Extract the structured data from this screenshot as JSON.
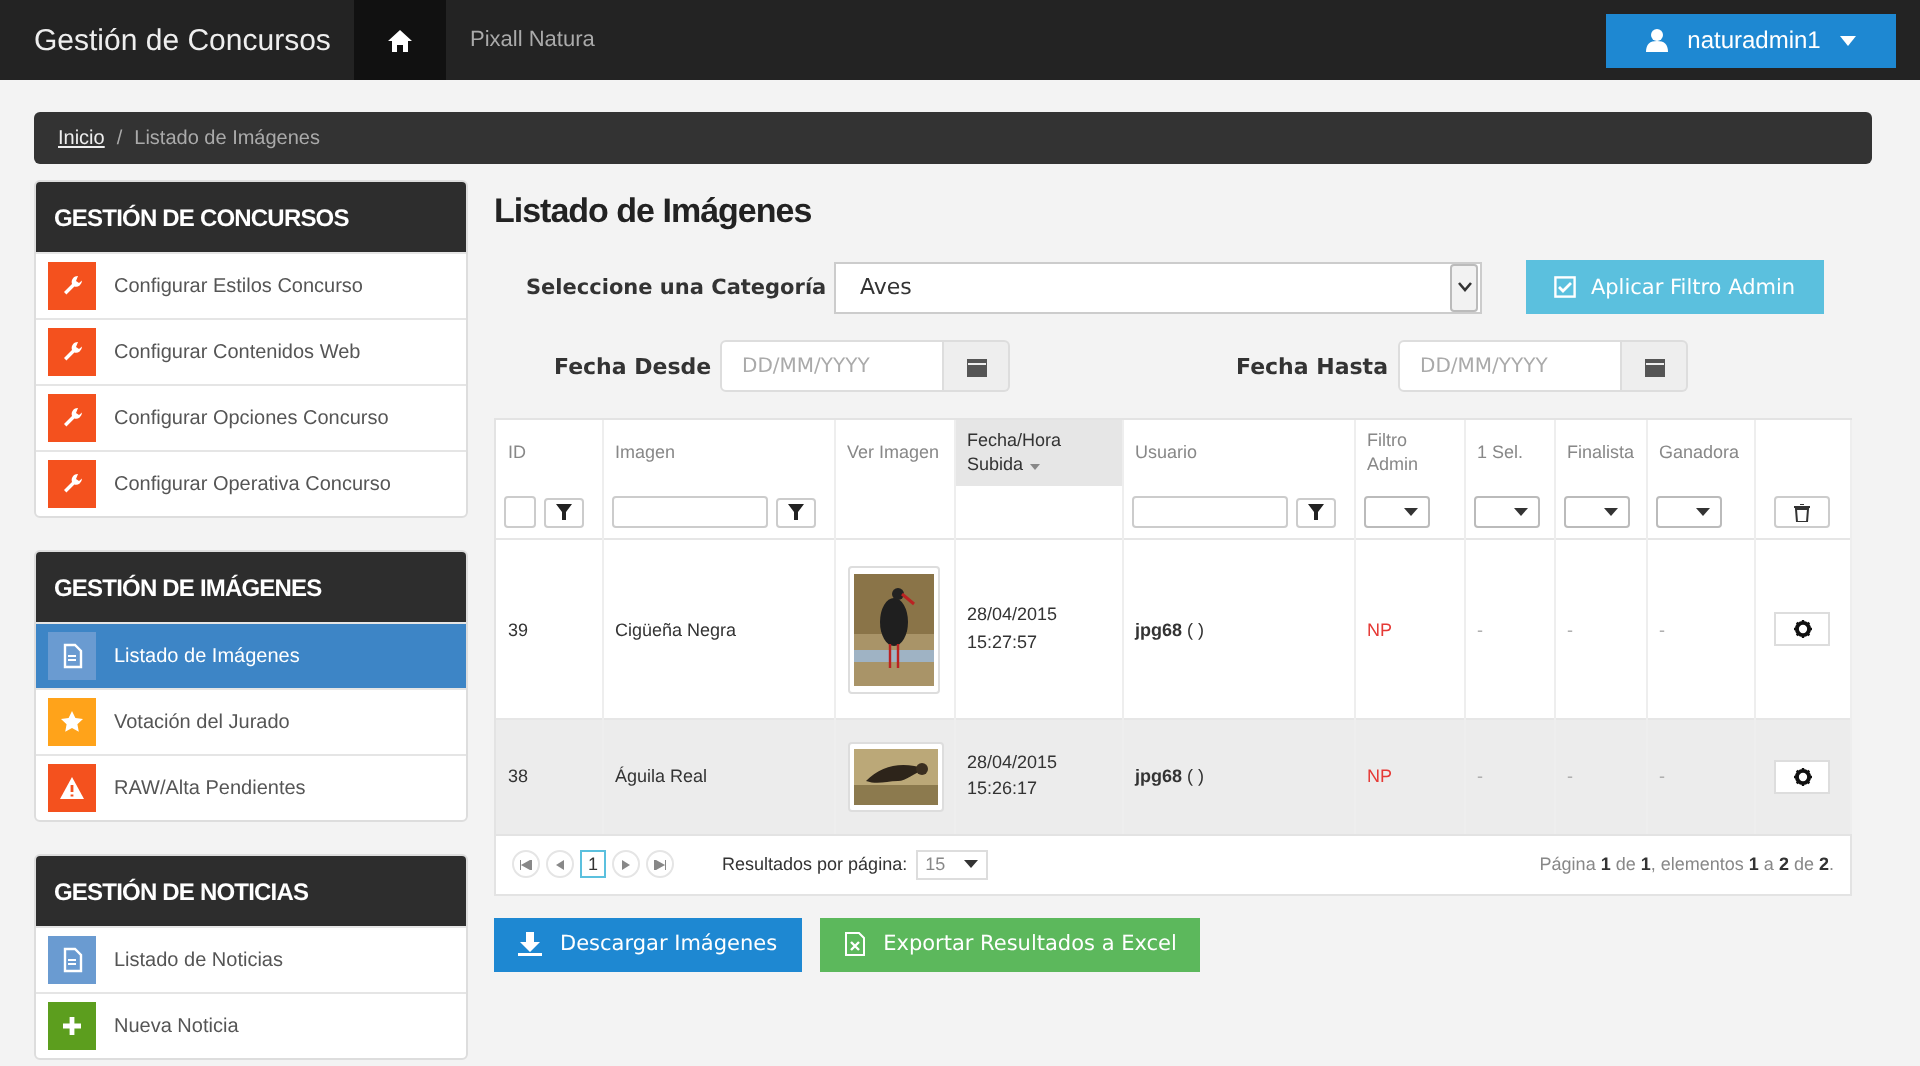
{
  "navbar": {
    "brand": "Gestión de Concursos",
    "home_selected": true,
    "site": "Pixall Natura",
    "user": "naturadmin1"
  },
  "breadcrumb": {
    "separator": "/",
    "items": [
      {
        "label": "Inicio",
        "link": true
      },
      {
        "label": "Listado de Imágenes",
        "link": false
      }
    ]
  },
  "sidebar": [
    {
      "title": "GESTIÓN DE CONCURSOS",
      "items": [
        {
          "label": "Configurar Estilos Concurso",
          "kind": "wrench",
          "color": "#f4511e",
          "selected": false
        },
        {
          "label": "Configurar Contenidos Web",
          "kind": "wrench",
          "color": "#f4511e",
          "selected": false
        },
        {
          "label": "Configurar Opciones Concurso",
          "kind": "wrench",
          "color": "#f4511e",
          "selected": false
        },
        {
          "label": "Configurar Operativa Concurso",
          "kind": "wrench",
          "color": "#f4511e",
          "selected": false
        }
      ]
    },
    {
      "title": "GESTIÓN DE IMÁGENES",
      "items": [
        {
          "label": "Listado de Imágenes",
          "kind": "file",
          "color": "#6a9bd1",
          "selected": true
        },
        {
          "label": "Votación del Jurado",
          "kind": "star",
          "color": "#ffa31a",
          "selected": false
        },
        {
          "label": "RAW/Alta Pendientes",
          "kind": "warning",
          "color": "#f4511e",
          "selected": false
        }
      ]
    },
    {
      "title": "GESTIÓN DE NOTICIAS",
      "items": [
        {
          "label": "Listado de Noticias",
          "kind": "file",
          "color": "#6a9bd1",
          "selected": false
        },
        {
          "label": "Nueva Noticia",
          "kind": "plus",
          "color": "#5c9e1e",
          "selected": false
        }
      ]
    }
  ],
  "page_title": "Listado de Imágenes",
  "filters": {
    "category_label": "Seleccione una Categoría",
    "category_value": "Aves",
    "apply_button": "Aplicar Filtro Admin",
    "from_label": "Fecha Desde",
    "from_placeholder": "DD/MM/YYYY",
    "to_label": "Fecha Hasta",
    "to_placeholder": "DD/MM/YYYY"
  },
  "table": {
    "select_all_checked": false,
    "columns": [
      {
        "label": "ID",
        "kind": "check-text",
        "sorted": false
      },
      {
        "label": "Imagen",
        "kind": "text",
        "sorted": false
      },
      {
        "label": "Ver Imagen",
        "kind": "none",
        "sorted": false
      },
      {
        "label": "Fecha/Hora Subida",
        "kind": "none",
        "sorted": true
      },
      {
        "label": "Usuario",
        "kind": "text",
        "sorted": false
      },
      {
        "label": "Filtro Admin",
        "kind": "select",
        "sorted": false
      },
      {
        "label": "1 Sel.",
        "kind": "select",
        "sorted": false
      },
      {
        "label": "Finalista",
        "kind": "select",
        "sorted": false
      },
      {
        "label": "Ganadora",
        "kind": "select",
        "sorted": false
      },
      {
        "kind": "delete",
        "sorted": false
      }
    ],
    "rows": [
      {
        "id": "39",
        "name": "Cigüeña Negra",
        "kind": "portrait",
        "date": "28/04/2015",
        "time": "15:27:57",
        "user": "jpg68",
        "user_extra": "( )",
        "admin": "NP",
        "sel1": "-",
        "finalist": "-",
        "winner": "-",
        "selected": false
      },
      {
        "id": "38",
        "name": "Águila Real",
        "kind": "landscape",
        "date": "28/04/2015",
        "time": "15:26:17",
        "user": "jpg68",
        "user_extra": "( )",
        "admin": "NP",
        "sel1": "-",
        "finalist": "-",
        "winner": "-",
        "selected": true
      }
    ],
    "pager": {
      "current": "1",
      "per_page_label": "Resultados por página:",
      "per_page": "15",
      "summary": "Página **1** de **1**, elementos **1** a **2** de **2**."
    }
  },
  "actions": [
    {
      "label": "Descargar Imágenes",
      "kind": "download"
    },
    {
      "label": "Exportar Resultados a Excel",
      "kind": "excel"
    }
  ]
}
